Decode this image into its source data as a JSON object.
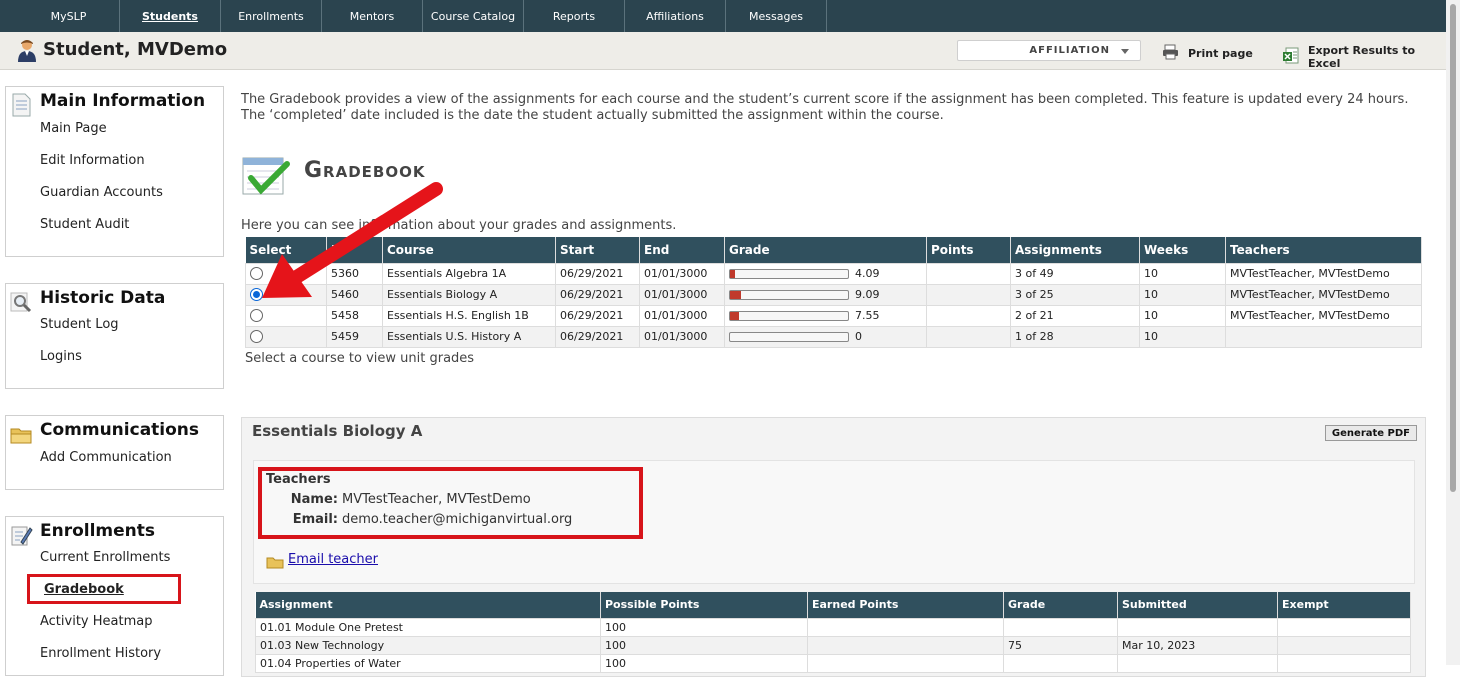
{
  "nav": {
    "tabs": [
      "MySLP",
      "Students",
      "Enrollments",
      "Mentors",
      "Course Catalog",
      "Reports",
      "Affiliations",
      "Messages"
    ],
    "active": "Students"
  },
  "header": {
    "student_name": "Student, MVDemo",
    "affiliation_label": "AFFILIATION",
    "print_label": "Print page",
    "export_label": "Export Results to Excel"
  },
  "sidebar": {
    "main_info": {
      "title": "Main Information",
      "links": [
        "Main Page",
        "Edit Information",
        "Guardian Accounts",
        "Student Audit"
      ]
    },
    "historic": {
      "title": "Historic Data",
      "links": [
        "Student Log",
        "Logins"
      ]
    },
    "communications": {
      "title": "Communications",
      "links": [
        "Add Communication"
      ]
    },
    "enrollments": {
      "title": "Enrollments",
      "links": [
        "Current Enrollments",
        "Gradebook",
        "Activity Heatmap",
        "Enrollment History"
      ],
      "current": "Gradebook"
    }
  },
  "main": {
    "intro": "The Gradebook provides a view of the assignments for each course and the student’s current score if the assignment has been completed. This feature is updated every 24 hours. The ‘completed’ date included is the date the student actually submitted the assignment within the course.",
    "title": "Gradebook",
    "subtitle": "Here you can see information about your grades and assignments.",
    "select_hint": "Select a course to view unit grades"
  },
  "courses_table": {
    "headers": [
      "Select",
      "ID",
      "Course",
      "Start",
      "End",
      "Grade",
      "Points",
      "Assignments",
      "Weeks",
      "Teachers"
    ],
    "rows": [
      {
        "id": "5360",
        "course": "Essentials Algebra 1A",
        "start": "06/29/2021",
        "end": "01/01/3000",
        "grade": "4.09",
        "grade_pct": 4.09,
        "points": "",
        "assignments": "3 of 49",
        "weeks": "10",
        "teachers": "MVTestTeacher, MVTestDemo",
        "selected": false
      },
      {
        "id": "5460",
        "course": "Essentials Biology A",
        "start": "06/29/2021",
        "end": "01/01/3000",
        "grade": "9.09",
        "grade_pct": 9.09,
        "points": "",
        "assignments": "3 of 25",
        "weeks": "10",
        "teachers": "MVTestTeacher, MVTestDemo",
        "selected": true
      },
      {
        "id": "5458",
        "course": "Essentials H.S. English 1B",
        "start": "06/29/2021",
        "end": "01/01/3000",
        "grade": "7.55",
        "grade_pct": 7.55,
        "points": "",
        "assignments": "2 of 21",
        "weeks": "10",
        "teachers": "MVTestTeacher, MVTestDemo",
        "selected": false
      },
      {
        "id": "5459",
        "course": "Essentials U.S. History A",
        "start": "06/29/2021",
        "end": "01/01/3000",
        "grade": "0",
        "grade_pct": 0,
        "points": "",
        "assignments": "1 of 28",
        "weeks": "10",
        "teachers": "",
        "selected": false
      }
    ]
  },
  "detail": {
    "course_title": "Essentials Biology A",
    "pdf_button": "Generate PDF",
    "teachers_heading": "Teachers",
    "name_label": "Name:",
    "name_value": "MVTestTeacher, MVTestDemo",
    "email_label": "Email:",
    "email_value": "demo.teacher@michiganvirtual.org",
    "email_link": "Email teacher"
  },
  "assignments_table": {
    "headers": [
      "Assignment",
      "Possible Points",
      "Earned Points",
      "Grade",
      "Submitted",
      "Exempt"
    ],
    "rows": [
      {
        "assignment": "01.01 Module One Pretest",
        "possible": "100",
        "earned": "",
        "grade": "",
        "submitted": "",
        "exempt": ""
      },
      {
        "assignment": "01.03 New Technology",
        "possible": "100",
        "earned": "",
        "grade": "75",
        "submitted": "Mar 10, 2023",
        "exempt": ""
      },
      {
        "assignment": "01.04 Properties of Water",
        "possible": "100",
        "earned": "",
        "grade": "",
        "submitted": "",
        "exempt": ""
      }
    ]
  },
  "colors": {
    "nav_bg": "#2b444f",
    "table_header": "#30505e",
    "highlight_red": "#d7141a",
    "grade_fill": "#c0392b"
  },
  "icons": [
    "user-icon",
    "print-icon",
    "excel-icon",
    "document-icon",
    "magnifier-icon",
    "folder-icon",
    "pencil-icon",
    "gradebook-check-icon",
    "envelope-icon",
    "red-arrow-annotation"
  ]
}
